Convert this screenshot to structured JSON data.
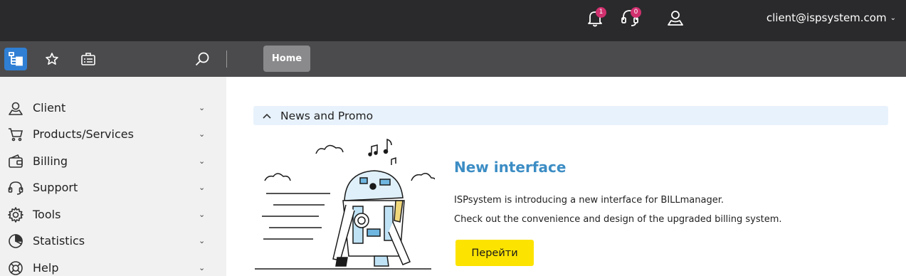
{
  "header": {
    "notifications_badge": "1",
    "support_badge": "0",
    "user_email": "client@ispsystem.com"
  },
  "toolbar": {
    "home_tab": "Home"
  },
  "sidebar": {
    "items": [
      {
        "label": "Client",
        "icon": "user-icon"
      },
      {
        "label": "Products/Services",
        "icon": "cart-icon"
      },
      {
        "label": "Billing",
        "icon": "wallet-icon"
      },
      {
        "label": "Support",
        "icon": "headset-icon"
      },
      {
        "label": "Tools",
        "icon": "gear-icon"
      },
      {
        "label": "Statistics",
        "icon": "pie-chart-icon"
      },
      {
        "label": "Help",
        "icon": "lifebuoy-icon"
      }
    ]
  },
  "main": {
    "section_title": "News and Promo",
    "promo": {
      "title": "New interface",
      "line1": "ISPsystem is introducing a new interface for BILLmanager.",
      "line2": "Check out the convenience and design of the upgraded billing system.",
      "button_label": "Перейти"
    }
  },
  "colors": {
    "topbar": "#2a2a2c",
    "toolbar": "#4b4b4d",
    "active_blue": "#2f7fd4",
    "badge": "#d1306f",
    "promo_title": "#3c8dc4",
    "button_yellow": "#fde300",
    "section_bg": "#e8f2fc"
  }
}
